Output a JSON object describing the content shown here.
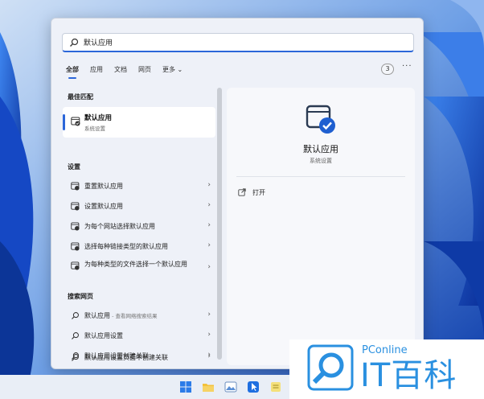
{
  "search": {
    "value": "默认应用"
  },
  "filter_tabs": [
    {
      "label": "全部",
      "active": true
    },
    {
      "label": "应用",
      "active": false
    },
    {
      "label": "文档",
      "active": false
    },
    {
      "label": "网页",
      "active": false
    },
    {
      "label": "更多 ⌄",
      "active": false
    }
  ],
  "result_count": "3",
  "more_options": "···",
  "best_match": {
    "section": "最佳匹配",
    "title": "默认应用",
    "subtitle": "系统设置"
  },
  "settings": {
    "section": "设置",
    "items": [
      {
        "label": "重置默认应用"
      },
      {
        "label": "设置默认应用"
      },
      {
        "label": "为每个网站选择默认应用"
      },
      {
        "label": "选择每种链接类型的默认应用"
      },
      {
        "label": "为每种类型的文件选择一个默认应用"
      }
    ]
  },
  "web_search": {
    "section": "搜索网页",
    "items": [
      {
        "label": "默认应用",
        "sub": " - 查看网络搜索结果"
      },
      {
        "label": "默认应用设置",
        "sub": ""
      },
      {
        "label": "默认应用设置创建关联",
        "sub": ""
      },
      {
        "label": "默认应用设置页面中创建关联",
        "sub": ""
      }
    ]
  },
  "preview": {
    "title": "默认应用",
    "subtitle": "系统设置",
    "open_label": "打开"
  },
  "watermark": {
    "top": "PConline",
    "brand": "IT百科"
  },
  "colors": {
    "accent": "#2b66d9",
    "brand": "#2a90e0"
  }
}
